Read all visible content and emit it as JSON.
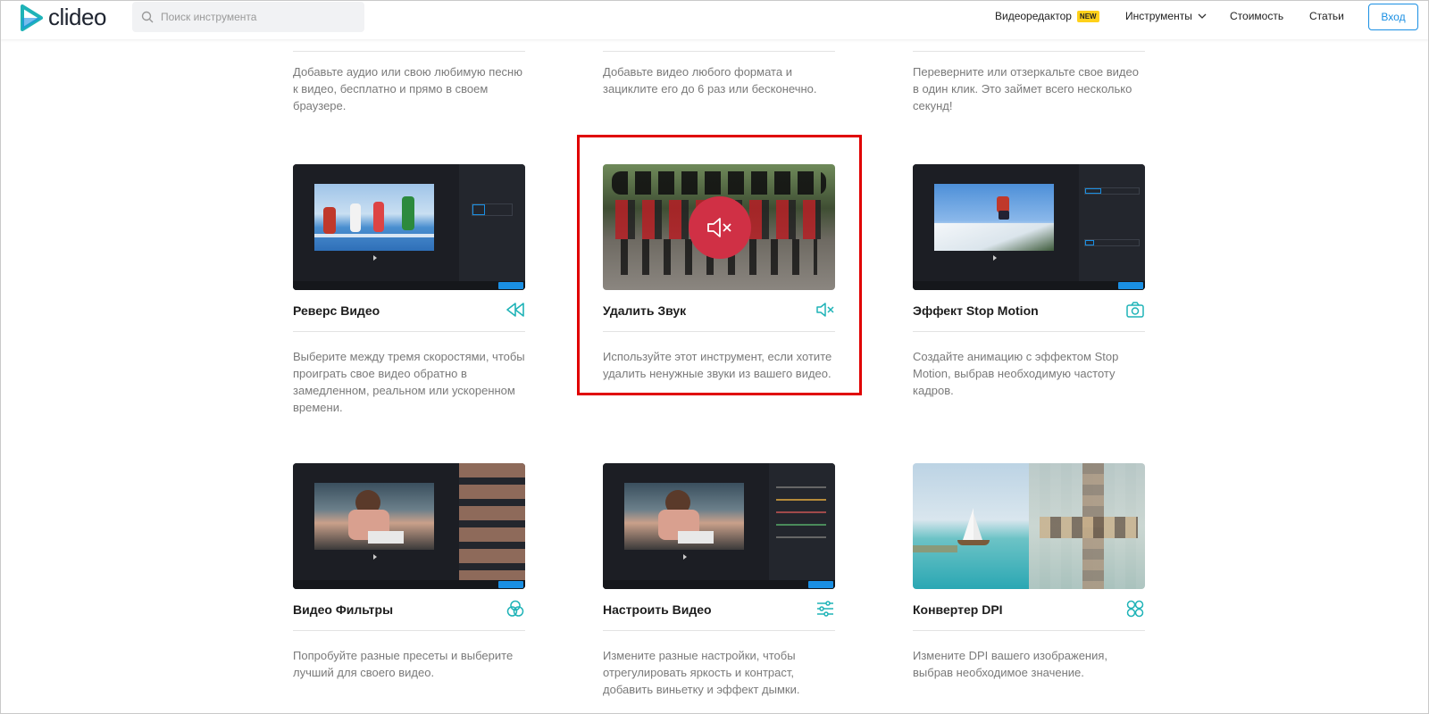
{
  "header": {
    "logo_text": "clideo",
    "search_placeholder": "Поиск инструмента",
    "nav_video_editor": "Видеоредактор",
    "nav_new_badge": "NEW",
    "nav_tools": "Инструменты",
    "nav_pricing": "Стоимость",
    "nav_articles": "Статьи",
    "login": "Вход"
  },
  "top_row": [
    {
      "desc": "Добавьте аудио или свою любимую песню к видео, бесплатно и прямо в своем браузере."
    },
    {
      "desc": "Добавьте видео любого формата и зациклите его до 6 раз или бесконечно."
    },
    {
      "desc": "Переверните или отзеркальте свое видео в один клик. Это займет всего несколько секунд!"
    }
  ],
  "cards": [
    {
      "title": "Реверс Видео",
      "desc": "Выберите между тремя скоростями, чтобы проиграть свое видео обратно в замедленном, реальном или ускоренном времени.",
      "icon": "rewind-icon"
    },
    {
      "title": "Удалить Звук",
      "desc": "Используйте этот инструмент, если хотите удалить ненужные звуки из вашего видео.",
      "icon": "mute-icon"
    },
    {
      "title": "Эффект Stop Motion",
      "desc": "Создайте анимацию с эффектом Stop Motion, выбрав необходимую частоту кадров.",
      "icon": "camera-icon"
    },
    {
      "title": "Видео Фильтры",
      "desc": "Попробуйте разные пресеты и выберите лучший для своего видео.",
      "icon": "circles-icon"
    },
    {
      "title": "Настроить Видео",
      "desc": "Измените разные настройки, чтобы отрегулировать яркость и контраст, добавить виньетку и эффект дымки.",
      "icon": "sliders-icon"
    },
    {
      "title": "Конвертер DPI",
      "desc": "Измените DPI вашего изображения, выбрав необходимое значение.",
      "icon": "dpi-icon"
    }
  ],
  "colors": {
    "accent": "#1a8fe3",
    "icon_teal": "#1fb3b7",
    "highlight": "#e00000",
    "mute_red": "#d03045"
  }
}
